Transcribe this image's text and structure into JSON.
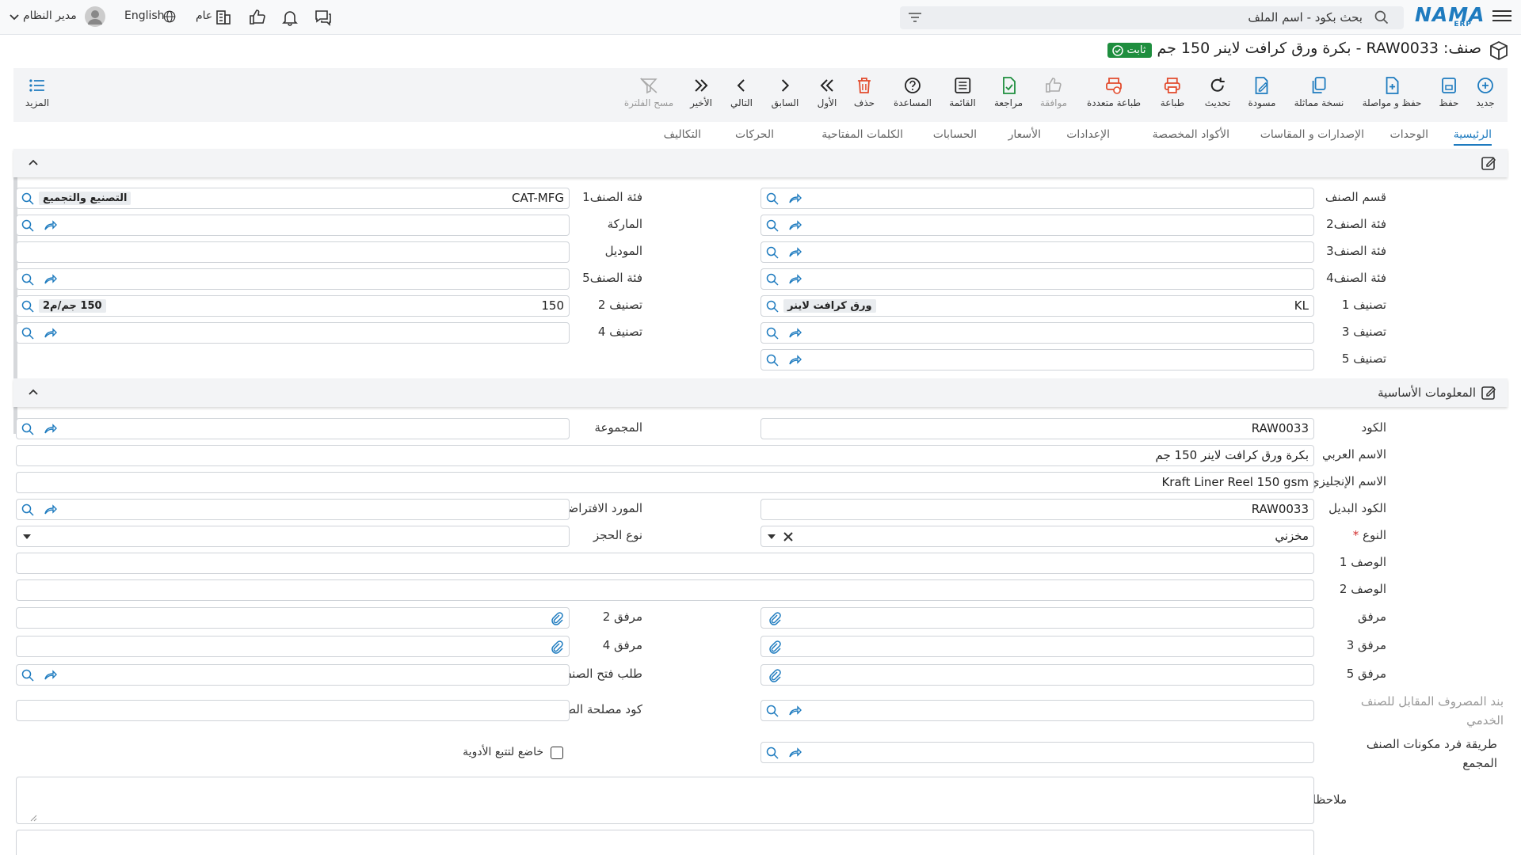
{
  "topbar": {
    "logo": "NAMA",
    "logo_sub": "ERP",
    "search_placeholder": "بحث بكود - اسم الملف",
    "user": "مدير النظام",
    "language": "English",
    "public": "عام"
  },
  "page": {
    "title": "صنف: RAW0033 - بكرة ورق كرافت لاينر 150 جم",
    "status": "ثابت"
  },
  "toolbar": {
    "new": "جديد",
    "save": "حفظ",
    "save_continue": "حفظ و مواصلة",
    "duplicate": "نسخة مماثلة",
    "draft": "مسودة",
    "refresh": "تحديث",
    "print": "طباعة",
    "multi_print": "طباعة متعددة",
    "approve": "موافقة",
    "review": "مراجعة",
    "list": "القائمة",
    "help": "المساعدة",
    "delete": "حذف",
    "first": "الأول",
    "previous": "السابق",
    "next": "التالي",
    "last": "الأخير",
    "clear_filter": "مسح الفلترة",
    "more": "المزيد"
  },
  "tabs": [
    "الرئيسية",
    "الوحدات",
    "الإصدارات و المقاسات",
    "الأكواد المخصصة",
    "الإعدادات",
    "الأسعار",
    "الحسابات",
    "الكلمات المفتاحية",
    "الحركات",
    "التكاليف"
  ],
  "section1": {
    "right": [
      {
        "label": "قسم الصنف",
        "value": ""
      },
      {
        "label": "فئة الصنف2",
        "value": ""
      },
      {
        "label": "فئة الصنف3",
        "value": ""
      },
      {
        "label": "فئة الصنف4",
        "value": ""
      },
      {
        "label": "تصنيف 1",
        "value": "KL",
        "tag": "ورق كرافت لاينر"
      },
      {
        "label": "تصنيف 3",
        "value": ""
      },
      {
        "label": "تصنيف 5",
        "value": ""
      }
    ],
    "left": [
      {
        "label": "فئة الصنف1",
        "value": "CAT-MFG",
        "tag": "التصنيع والتجميع"
      },
      {
        "label": "الماركة",
        "value": ""
      },
      {
        "label": "الموديل",
        "value": ""
      },
      {
        "label": "فئة الصنف5",
        "value": ""
      },
      {
        "label": "تصنيف 2",
        "value": "150",
        "tag": "150 جم/م2"
      },
      {
        "label": "تصنيف 4",
        "value": ""
      }
    ]
  },
  "section2": {
    "title": "المعلومات الأساسية",
    "code_label": "الكود",
    "code": "RAW0033",
    "group_label": "المجموعة",
    "arabic_name_label": "الاسم العربي",
    "arabic_name": "بكرة ورق كرافت لاينر 150 جم",
    "english_name_label": "الاسم الإنجليزي",
    "english_name": "Kraft Liner Reel 150 gsm",
    "alt_code_label": "الكود البديل",
    "alt_code": "RAW0033",
    "default_supplier_label": "المورد الافتراضي",
    "type_label": "النوع",
    "type_required": "*",
    "type": "مخزني",
    "booking_type_label": "نوع الحجز",
    "desc1_label": "الوصف 1",
    "desc2_label": "الوصف 2",
    "attach_label": "مرفق",
    "attach2_label": "مرفق 2",
    "attach3_label": "مرفق 3",
    "attach4_label": "مرفق 4",
    "attach5_label": "مرفق 5",
    "open_request_label": "طلب فتح الصنف",
    "expense_item_label": "بند المصروف المقابل للصنف الخدمي",
    "tax_code_label": "كود مصلحة الضرائب",
    "bundle_method_label": "طريقة فرد مكونات الصنف المجمع",
    "drug_tracking_label": "خاضع لتتبع الأدوية",
    "notes_label": "ملاحظات"
  },
  "colors": {
    "brand": "#1e7bbf",
    "status": "#1e8e3e",
    "accent_icon": "#1e7bbf",
    "danger": "#e24b2d"
  }
}
